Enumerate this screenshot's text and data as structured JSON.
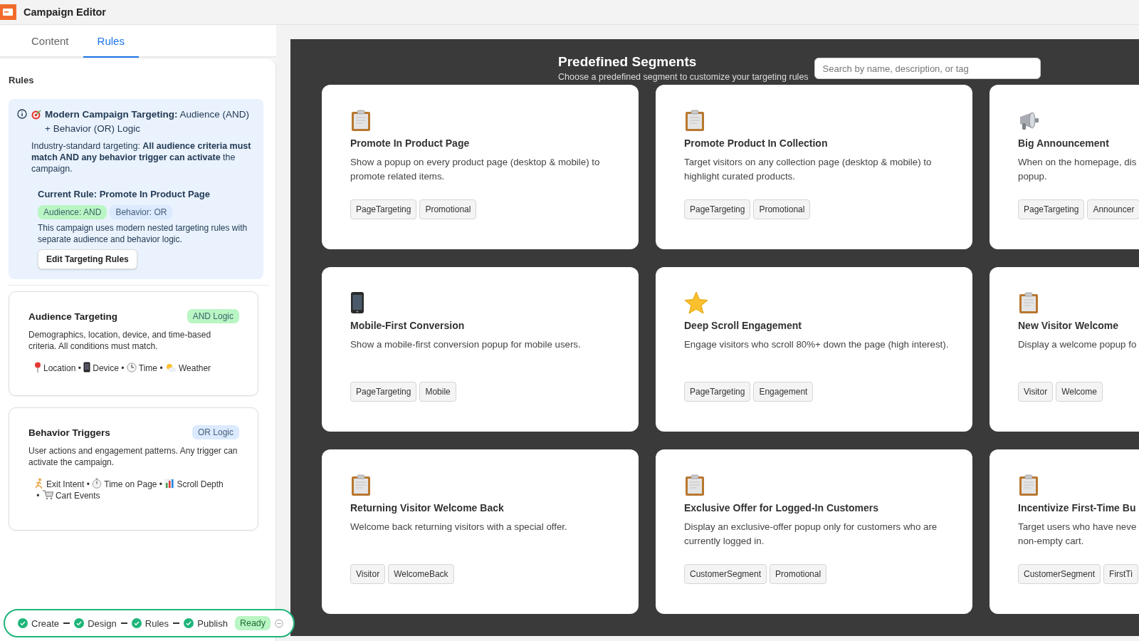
{
  "window": {
    "title": "Campaign Editor"
  },
  "tabs": [
    {
      "label": "Content",
      "selected": false
    },
    {
      "label": "Rules",
      "selected": true
    }
  ],
  "rules_panel": {
    "heading": "Rules",
    "info": {
      "title": "**Modern Campaign Targeting:** Audience (AND) + Behavior (OR) Logic",
      "body": "Industry-standard targeting: **All audience criteria must match AND any behavior trigger can activate** the campaign.",
      "current_rule": "Current Rule: Promote In Product Page",
      "pills": [
        {
          "label": "Audience: AND",
          "color": "#b9f6c4"
        },
        {
          "label": "Behavior: OR",
          "color": "#dbeafe"
        }
      ],
      "note": "This campaign uses modern nested targeting rules with separate audience and behavior logic.",
      "button": "Edit Targeting Rules"
    },
    "sections": [
      {
        "title": "Audience Targeting",
        "badge": {
          "label": "AND Logic",
          "color": "#b9f6c4"
        },
        "description": "Demographics, location, device, and time-based criteria. All conditions must match.",
        "separator": "•",
        "items": [
          {
            "kind": "pin",
            "label": "Location"
          },
          {
            "kind": "phone",
            "label": "Device"
          },
          {
            "kind": "clock",
            "label": "Time"
          },
          {
            "kind": "weather",
            "label": "Weather"
          }
        ]
      },
      {
        "title": "Behavior Triggers",
        "badge": {
          "label": "OR Logic",
          "color": "#dbeafe"
        },
        "description": "User actions and engagement patterns. Any trigger can activate the campaign.",
        "separator": "•",
        "items": [
          {
            "kind": "runner",
            "label": "Exit Intent"
          },
          {
            "kind": "stopwatch",
            "label": "Time on Page"
          },
          {
            "kind": "chart",
            "label": "Scroll Depth"
          },
          {
            "kind": "cart",
            "label": "Cart Events"
          }
        ]
      }
    ]
  },
  "segments": {
    "title": "Predefined Segments",
    "subtitle": "Choose a predefined segment to customize your targeting rules",
    "search": {
      "placeholder": "Search by name, description, or tag"
    },
    "cards": [
      {
        "kind": "clipboard",
        "title": "Promote In Product Page",
        "description": "Show a popup on every product page (desktop & mobile) to promote related items.",
        "tags": [
          "PageTargeting",
          "Promotional"
        ]
      },
      {
        "kind": "clipboard",
        "title": "Promote Product In Collection",
        "description": "Target visitors on any collection page (desktop & mobile) to highlight curated products.",
        "tags": [
          "PageTargeting",
          "Promotional"
        ]
      },
      {
        "kind": "megaphone",
        "title": "Big Announcement",
        "description": "When on the homepage, dis\npopup.",
        "tags": [
          "PageTargeting",
          "Announcer"
        ]
      },
      {
        "kind": "phone",
        "title": "Mobile-First Conversion",
        "description": "Show a mobile-first conversion popup for mobile users.",
        "tags": [
          "PageTargeting",
          "Mobile"
        ]
      },
      {
        "kind": "star",
        "title": "Deep Scroll Engagement",
        "description": "Engage visitors who scroll 80%+ down the page (high interest).",
        "tags": [
          "PageTargeting",
          "Engagement"
        ]
      },
      {
        "kind": "clipboard",
        "title": "New Visitor Welcome",
        "description": "Display a welcome popup fo",
        "tags": [
          "Visitor",
          "Welcome"
        ]
      },
      {
        "kind": "clipboard",
        "title": "Returning Visitor Welcome Back",
        "description": "Welcome back returning visitors with a special offer.",
        "tags": [
          "Visitor",
          "WelcomeBack"
        ]
      },
      {
        "kind": "clipboard",
        "title": "Exclusive Offer for Logged-In Customers",
        "description": "Display an exclusive-offer popup only for customers who are currently logged in.",
        "tags": [
          "CustomerSegment",
          "Promotional"
        ]
      },
      {
        "kind": "clipboard",
        "title": "Incentivize First-Time Bu",
        "description": "Target users who have neve\nnon-empty cart.",
        "tags": [
          "CustomerSegment",
          "FirstTi"
        ]
      }
    ]
  },
  "progress": {
    "steps": [
      {
        "label": "Create",
        "done": true
      },
      {
        "label": "Design",
        "done": true
      },
      {
        "label": "Rules",
        "done": true
      },
      {
        "label": "Publish",
        "done": true
      }
    ],
    "status": "Ready"
  }
}
